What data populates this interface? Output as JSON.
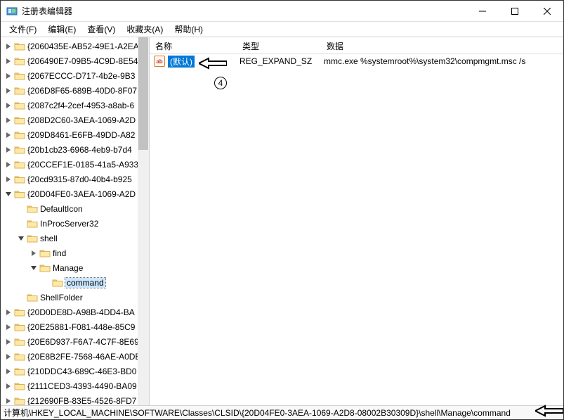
{
  "window": {
    "title": "注册表编辑器"
  },
  "menu": {
    "file": "文件(F)",
    "edit": "编辑(E)",
    "view": "查看(V)",
    "favorites": "收藏夹(A)",
    "help": "帮助(H)"
  },
  "tree": {
    "items": [
      {
        "indent": 0,
        "toggle": ">",
        "label": "{2060435E-AB52-49E1-A2EA"
      },
      {
        "indent": 0,
        "toggle": ">",
        "label": "{206490E7-09B5-4C9D-8E54"
      },
      {
        "indent": 0,
        "toggle": ">",
        "label": "{2067ECCC-D717-4b2e-9B3"
      },
      {
        "indent": 0,
        "toggle": ">",
        "label": "{206D8F65-689B-40D0-8F07"
      },
      {
        "indent": 0,
        "toggle": ">",
        "label": "{2087c2f4-2cef-4953-a8ab-6"
      },
      {
        "indent": 0,
        "toggle": ">",
        "label": "{208D2C60-3AEA-1069-A2D"
      },
      {
        "indent": 0,
        "toggle": ">",
        "label": "{209D8461-E6FB-49DD-A82"
      },
      {
        "indent": 0,
        "toggle": ">",
        "label": "{20b1cb23-6968-4eb9-b7d4"
      },
      {
        "indent": 0,
        "toggle": ">",
        "label": "{20CCEF1E-0185-41a5-A933"
      },
      {
        "indent": 0,
        "toggle": ">",
        "label": "{20cd9315-87d0-40b4-b925"
      },
      {
        "indent": 0,
        "toggle": "v",
        "label": "{20D04FE0-3AEA-1069-A2D"
      },
      {
        "indent": 1,
        "toggle": "",
        "label": "DefaultIcon"
      },
      {
        "indent": 1,
        "toggle": "",
        "label": "InProcServer32"
      },
      {
        "indent": 1,
        "toggle": "v",
        "label": "shell"
      },
      {
        "indent": 2,
        "toggle": ">",
        "label": "find"
      },
      {
        "indent": 2,
        "toggle": "v",
        "label": "Manage"
      },
      {
        "indent": 3,
        "toggle": "",
        "label": "command",
        "selected": true
      },
      {
        "indent": 1,
        "toggle": "",
        "label": "ShellFolder"
      },
      {
        "indent": 0,
        "toggle": ">",
        "label": "{20D0DE8D-A98B-4DD4-BA"
      },
      {
        "indent": 0,
        "toggle": ">",
        "label": "{20E25881-F081-448e-85C9"
      },
      {
        "indent": 0,
        "toggle": ">",
        "label": "{20E6D937-F6A7-4C7F-8E69"
      },
      {
        "indent": 0,
        "toggle": ">",
        "label": "{20E8B2FE-7568-46AE-A0DB"
      },
      {
        "indent": 0,
        "toggle": ">",
        "label": "{210DDC43-689C-46E3-BD0"
      },
      {
        "indent": 0,
        "toggle": ">",
        "label": "{2111CED3-4393-4490-BA09"
      },
      {
        "indent": 0,
        "toggle": ">",
        "label": "{212690FB-83E5-4526-8FD7"
      }
    ]
  },
  "list": {
    "columns": {
      "name": "名称",
      "type": "类型",
      "data": "数据"
    },
    "rows": [
      {
        "icon_text": "ab",
        "name": "(默认)",
        "type": "REG_EXPAND_SZ",
        "data": "mmc.exe %systemroot%\\system32\\compmgmt.msc /s"
      }
    ]
  },
  "statusbar": {
    "path": "计算机\\HKEY_LOCAL_MACHINE\\SOFTWARE\\Classes\\CLSID\\{20D04FE0-3AEA-1069-A2D8-08002B30309D}\\shell\\Manage\\command"
  },
  "annotation": {
    "step": "4"
  }
}
